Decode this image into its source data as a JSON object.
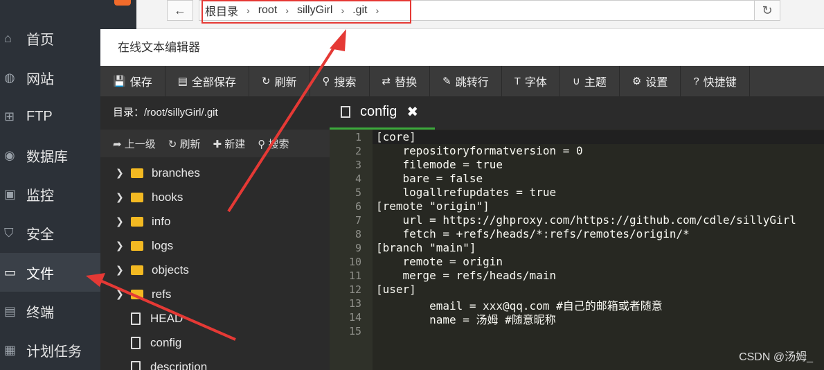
{
  "sidebar": {
    "top_label": "",
    "items": [
      {
        "label": "首页",
        "icon": "home-icon"
      },
      {
        "label": "网站",
        "icon": "globe-icon"
      },
      {
        "label": "FTP",
        "icon": "ftp-icon"
      },
      {
        "label": "数据库",
        "icon": "database-icon"
      },
      {
        "label": "监控",
        "icon": "monitor-icon"
      },
      {
        "label": "安全",
        "icon": "shield-icon"
      },
      {
        "label": "文件",
        "icon": "folder-icon"
      },
      {
        "label": "终端",
        "icon": "terminal-icon"
      },
      {
        "label": "计划任务",
        "icon": "calendar-icon"
      }
    ]
  },
  "breadcrumb": {
    "items": [
      "根目录",
      "root",
      "sillyGirl",
      ".git"
    ],
    "separator": "›"
  },
  "editor": {
    "title": "在线文本编辑器",
    "toolbar": [
      {
        "label": "保存",
        "icon": "save-icon"
      },
      {
        "label": "全部保存",
        "icon": "save-all-icon"
      },
      {
        "label": "刷新",
        "icon": "refresh-icon"
      },
      {
        "label": "搜索",
        "icon": "search-icon"
      },
      {
        "label": "替换",
        "icon": "replace-icon"
      },
      {
        "label": "跳转行",
        "icon": "pin-icon"
      },
      {
        "label": "字体",
        "icon": "font-icon"
      },
      {
        "label": "主题",
        "icon": "magnet-icon"
      },
      {
        "label": "设置",
        "icon": "gear-icon"
      },
      {
        "label": "快捷键",
        "icon": "help-icon"
      }
    ],
    "dir_label": "目录：/root/sillyGirl/.git",
    "dir_tools": [
      "上一级",
      "刷新",
      "新建",
      "搜索"
    ],
    "tree": [
      {
        "name": "branches",
        "type": "folder"
      },
      {
        "name": "hooks",
        "type": "folder"
      },
      {
        "name": "info",
        "type": "folder"
      },
      {
        "name": "logs",
        "type": "folder"
      },
      {
        "name": "objects",
        "type": "folder"
      },
      {
        "name": "refs",
        "type": "folder"
      },
      {
        "name": "HEAD",
        "type": "file"
      },
      {
        "name": "config",
        "type": "file"
      },
      {
        "name": "description",
        "type": "file"
      }
    ],
    "tab": {
      "label": "config",
      "close": "✖"
    },
    "code": [
      "[core]",
      "    repositoryformatversion = 0",
      "    filemode = true",
      "    bare = false",
      "    logallrefupdates = true",
      "[remote \"origin\"]",
      "    url = https://ghproxy.com/https://github.com/cdle/sillyGirl",
      "    fetch = +refs/heads/*:refs/remotes/origin/*",
      "[branch \"main\"]",
      "    remote = origin",
      "    merge = refs/heads/main",
      "[user]",
      "        email = xxx@qq.com #自己的邮箱或者随意",
      "        name = 汤姆 #随意昵称",
      ""
    ]
  },
  "watermark": "CSDN @汤姆_",
  "colors": {
    "sidebar_bg": "#2c3138",
    "annotation": "#e53935",
    "tab_underline": "#3caa3c"
  }
}
